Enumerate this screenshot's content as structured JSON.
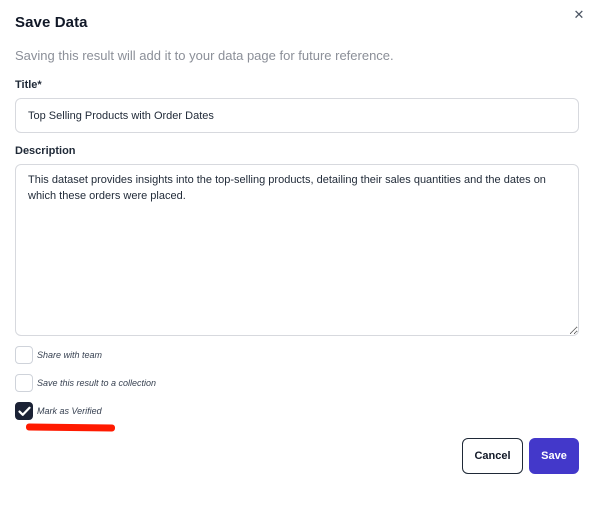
{
  "dialog": {
    "title": "Save Data",
    "close_icon": "close-icon",
    "close_glyph": "✕",
    "subtitle": "Saving this result will add it to your data page for future reference."
  },
  "form": {
    "title_label": "Title*",
    "title_value": "Top Selling Products with Order Dates",
    "description_label": "Description",
    "description_value": "This dataset provides insights into the top-selling products, detailing their sales quantities and the dates on which these orders were placed."
  },
  "options": [
    {
      "label": "Share with team",
      "checked": false
    },
    {
      "label": "Save this result to a collection",
      "checked": false
    },
    {
      "label": "Mark as Verified",
      "checked": true
    }
  ],
  "actions": {
    "cancel_label": "Cancel",
    "save_label": "Save"
  },
  "colors": {
    "primary": "#4338ca",
    "checked_box": "#1b2235",
    "annotation": "#ff1a00"
  }
}
